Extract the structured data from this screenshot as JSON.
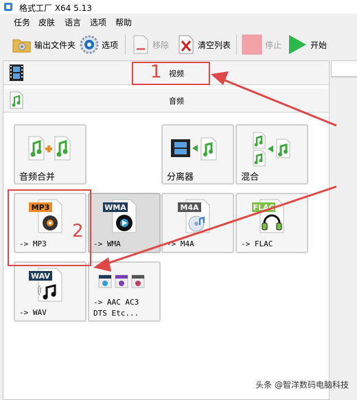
{
  "window": {
    "title": "格式工厂 X64 5.13"
  },
  "menu": [
    "任务",
    "皮肤",
    "语言",
    "选项",
    "帮助"
  ],
  "toolbar": {
    "output_folder": "输出文件夹",
    "options": "选项",
    "remove": "移除",
    "clear_list": "清空列表",
    "stop": "停止",
    "start": "开始"
  },
  "categories": {
    "video": "视频",
    "audio": "音频"
  },
  "tiles": [
    {
      "label": "音频合并",
      "icon": "audio-merge-icon"
    },
    {
      "label": "分离器",
      "icon": "splitter-icon"
    },
    {
      "label": "混合",
      "icon": "mix-icon"
    },
    {
      "label": "-> MP3",
      "badge": "MP3",
      "icon": "mp3-file-icon"
    },
    {
      "label": "-> WMA",
      "badge": "WMA",
      "icon": "wma-file-icon"
    },
    {
      "label": "-> M4A",
      "badge": "M4A",
      "icon": "m4a-file-icon"
    },
    {
      "label": "-> FLAC",
      "badge": "FLAC",
      "icon": "flac-file-icon"
    },
    {
      "label": "-> WAV",
      "badge": "WAV",
      "icon": "wav-file-icon"
    },
    {
      "label": "-> AAC AC3\nDTS Etc...",
      "icon": "multi-format-icon"
    }
  ],
  "annotations": {
    "one": "1",
    "two": "2"
  },
  "watermark": "头条 @智洋数码电脑科技",
  "colors": {
    "accent_red": "#e04848",
    "start_green": "#2db84a",
    "badge_orange": "#f08a24",
    "badge_navy": "#1e3b5c",
    "badge_gray": "#555555",
    "badge_green": "#7cc142"
  }
}
